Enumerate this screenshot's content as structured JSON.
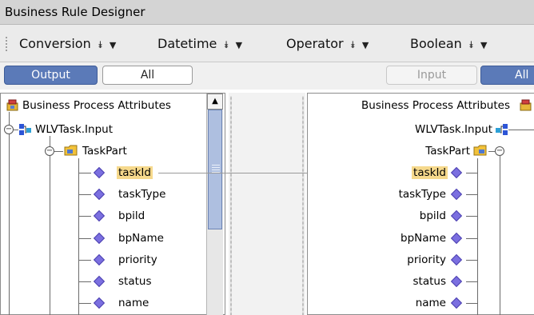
{
  "window": {
    "title": "Business Rule Designer"
  },
  "menu": {
    "items": [
      {
        "label": "Conversion"
      },
      {
        "label": "Datetime"
      },
      {
        "label": "Operator"
      },
      {
        "label": "Boolean"
      }
    ]
  },
  "left_tabs": {
    "active": "Output",
    "inactive": "All"
  },
  "right_tabs": {
    "disabled": "Input",
    "active": "All"
  },
  "left_tree": {
    "root": "Business Process Attributes",
    "level1": "WLVTask.Input",
    "level2": "TaskPart",
    "fields": [
      "taskId",
      "taskType",
      "bpild",
      "bpName",
      "priority",
      "status",
      "name"
    ]
  },
  "right_tree": {
    "root": "Business Process Attributes",
    "level1": "WLVTask.Input",
    "level2": "TaskPart",
    "fields": [
      "taskId",
      "taskType",
      "bpild",
      "bpName",
      "priority",
      "status",
      "name"
    ]
  },
  "selection": {
    "field": "taskId",
    "highlight_color": "#f6d98c"
  },
  "colors": {
    "active_tab": "#5b7ab8",
    "diamond": "#7b6fe0",
    "mapping_line": "#9a9a9a"
  }
}
